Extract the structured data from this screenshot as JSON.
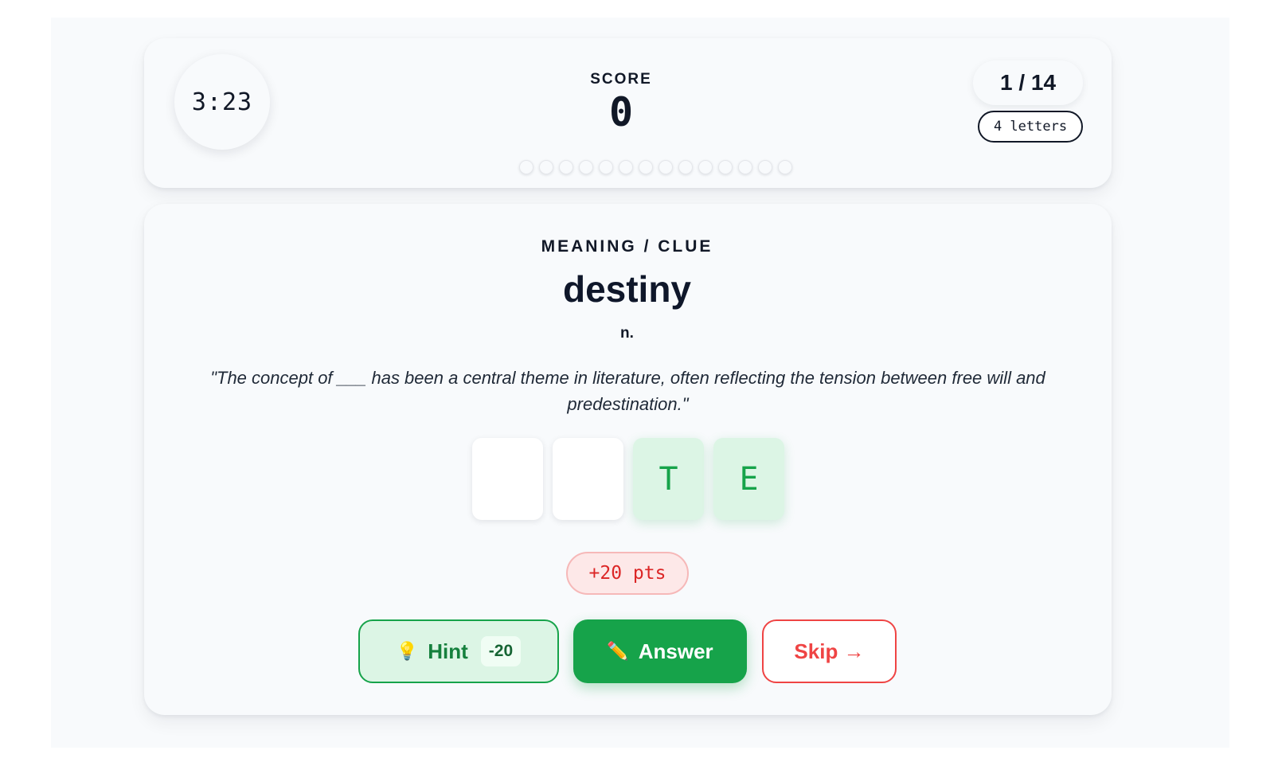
{
  "header": {
    "timer": "3:23",
    "score_label": "SCORE",
    "score_value": "0",
    "progress_text": "1 / 14",
    "letters_badge": "4 letters",
    "dots_total": 14
  },
  "clue": {
    "label": "MEANING / CLUE",
    "word": "destiny",
    "part_of_speech": "n.",
    "sentence": "\"The concept of ___ has been a central theme in literature, often reflecting the tension between free will and predestination.\""
  },
  "tiles": [
    {
      "letter": "",
      "revealed": false
    },
    {
      "letter": "",
      "revealed": false
    },
    {
      "letter": "T",
      "revealed": true
    },
    {
      "letter": "E",
      "revealed": true
    }
  ],
  "points_badge": "+20 pts",
  "actions": {
    "hint_label": "Hint",
    "hint_cost": "-20",
    "answer_label": "Answer",
    "skip_label": "Skip →"
  },
  "icons": {
    "hint": "lightbulb-icon",
    "answer": "pencil-icon"
  },
  "colors": {
    "accent_green": "#16a34a",
    "danger_red": "#ef4444"
  }
}
